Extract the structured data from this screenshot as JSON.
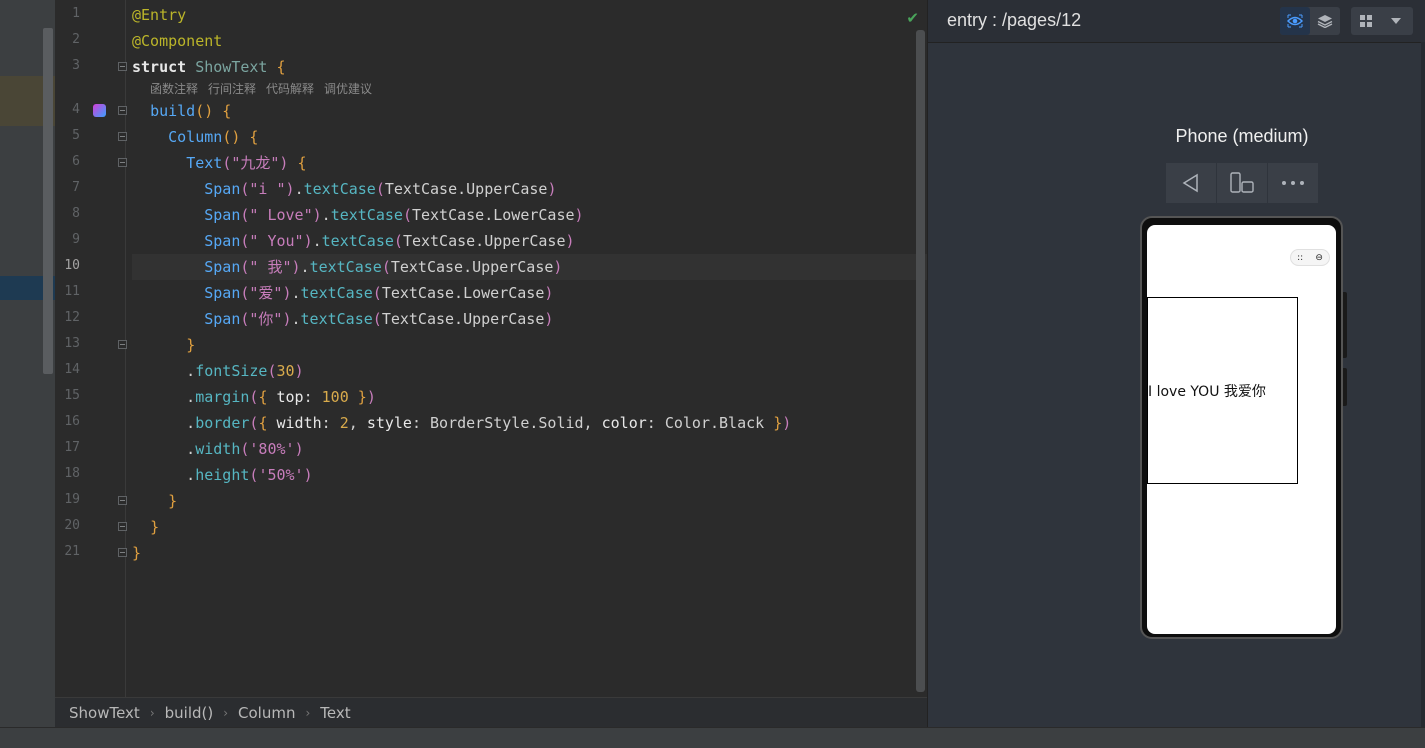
{
  "editor": {
    "lines": [
      {
        "n": "1",
        "tokens": [
          [
            "t-ann",
            "@Entry"
          ]
        ]
      },
      {
        "n": "2",
        "tokens": [
          [
            "t-ann",
            "@Component"
          ]
        ]
      },
      {
        "n": "3",
        "tokens": [
          [
            "t-kwp",
            "struct "
          ],
          [
            "t-cls",
            "ShowText "
          ],
          [
            "t-br",
            "{"
          ]
        ]
      },
      {
        "n": "4",
        "tokens": [
          [
            "t-plain",
            "  "
          ],
          [
            "t-fn",
            "build"
          ],
          [
            "t-br",
            "() {"
          ]
        ]
      },
      {
        "n": "5",
        "tokens": [
          [
            "t-plain",
            "    "
          ],
          [
            "t-fn",
            "Column"
          ],
          [
            "t-br",
            "() {"
          ]
        ]
      },
      {
        "n": "6",
        "tokens": [
          [
            "t-plain",
            "      "
          ],
          [
            "t-fn",
            "Text"
          ],
          [
            "t-br2",
            "("
          ],
          [
            "t-str",
            "\"九龙\""
          ],
          [
            "t-br2",
            ")"
          ],
          [
            "t-br",
            " {"
          ]
        ]
      },
      {
        "n": "7",
        "tokens": [
          [
            "t-plain",
            "        "
          ],
          [
            "t-fn",
            "Span"
          ],
          [
            "t-br2",
            "("
          ],
          [
            "t-str",
            "\"i \""
          ],
          [
            "t-br2",
            ")"
          ],
          [
            "t-plain",
            "."
          ],
          [
            "t-mth",
            "textCase"
          ],
          [
            "t-br2",
            "("
          ],
          [
            "t-plain",
            "TextCase.UpperCase"
          ],
          [
            "t-br2",
            ")"
          ]
        ]
      },
      {
        "n": "8",
        "tokens": [
          [
            "t-plain",
            "        "
          ],
          [
            "t-fn",
            "Span"
          ],
          [
            "t-br2",
            "("
          ],
          [
            "t-str",
            "\" Love\""
          ],
          [
            "t-br2",
            ")"
          ],
          [
            "t-plain",
            "."
          ],
          [
            "t-mth",
            "textCase"
          ],
          [
            "t-br2",
            "("
          ],
          [
            "t-plain",
            "TextCase.LowerCase"
          ],
          [
            "t-br2",
            ")"
          ]
        ]
      },
      {
        "n": "9",
        "tokens": [
          [
            "t-plain",
            "        "
          ],
          [
            "t-fn",
            "Span"
          ],
          [
            "t-br2",
            "("
          ],
          [
            "t-str",
            "\" You\""
          ],
          [
            "t-br2",
            ")"
          ],
          [
            "t-plain",
            "."
          ],
          [
            "t-mth",
            "textCase"
          ],
          [
            "t-br2",
            "("
          ],
          [
            "t-plain",
            "TextCase.UpperCase"
          ],
          [
            "t-br2",
            ")"
          ]
        ]
      },
      {
        "n": "10",
        "tokens": [
          [
            "t-plain",
            "        "
          ],
          [
            "t-fn",
            "Span"
          ],
          [
            "t-br2",
            "("
          ],
          [
            "t-str",
            "\" 我\""
          ],
          [
            "t-br2",
            ")"
          ],
          [
            "t-plain",
            "."
          ],
          [
            "t-mth",
            "textCase"
          ],
          [
            "t-br2",
            "("
          ],
          [
            "t-plain",
            "TextCase.UpperCase"
          ],
          [
            "t-br2",
            ")"
          ]
        ]
      },
      {
        "n": "11",
        "tokens": [
          [
            "t-plain",
            "        "
          ],
          [
            "t-fn",
            "Span"
          ],
          [
            "t-br2",
            "("
          ],
          [
            "t-str",
            "\"爱\""
          ],
          [
            "t-br2",
            ")"
          ],
          [
            "t-plain",
            "."
          ],
          [
            "t-mth",
            "textCase"
          ],
          [
            "t-br2",
            "("
          ],
          [
            "t-plain",
            "TextCase.LowerCase"
          ],
          [
            "t-br2",
            ")"
          ]
        ]
      },
      {
        "n": "12",
        "tokens": [
          [
            "t-plain",
            "        "
          ],
          [
            "t-fn",
            "Span"
          ],
          [
            "t-br2",
            "("
          ],
          [
            "t-str",
            "\"你\""
          ],
          [
            "t-br2",
            ")"
          ],
          [
            "t-plain",
            "."
          ],
          [
            "t-mth",
            "textCase"
          ],
          [
            "t-br2",
            "("
          ],
          [
            "t-plain",
            "TextCase.UpperCase"
          ],
          [
            "t-br2",
            ")"
          ]
        ]
      },
      {
        "n": "13",
        "tokens": [
          [
            "t-plain",
            "      "
          ],
          [
            "t-br",
            "}"
          ]
        ]
      },
      {
        "n": "14",
        "tokens": [
          [
            "t-plain",
            "      ."
          ],
          [
            "t-mth",
            "fontSize"
          ],
          [
            "t-br2",
            "("
          ],
          [
            "t-num",
            "30"
          ],
          [
            "t-br2",
            ")"
          ]
        ]
      },
      {
        "n": "15",
        "tokens": [
          [
            "t-plain",
            "      ."
          ],
          [
            "t-mth",
            "margin"
          ],
          [
            "t-br2",
            "("
          ],
          [
            "t-br",
            "{ "
          ],
          [
            "t-prop",
            "top"
          ],
          [
            "t-plain",
            ": "
          ],
          [
            "t-num",
            "100"
          ],
          [
            "t-br",
            " }"
          ],
          [
            "t-br2",
            ")"
          ]
        ]
      },
      {
        "n": "16",
        "tokens": [
          [
            "t-plain",
            "      ."
          ],
          [
            "t-mth",
            "border"
          ],
          [
            "t-br2",
            "("
          ],
          [
            "t-br",
            "{ "
          ],
          [
            "t-prop",
            "width"
          ],
          [
            "t-plain",
            ": "
          ],
          [
            "t-num",
            "2"
          ],
          [
            "t-plain",
            ", "
          ],
          [
            "t-prop",
            "style"
          ],
          [
            "t-plain",
            ": BorderStyle.Solid, "
          ],
          [
            "t-prop",
            "color"
          ],
          [
            "t-plain",
            ": Color.Black "
          ],
          [
            "t-br",
            "}"
          ],
          [
            "t-br2",
            ")"
          ]
        ]
      },
      {
        "n": "17",
        "tokens": [
          [
            "t-plain",
            "      ."
          ],
          [
            "t-mth",
            "width"
          ],
          [
            "t-br2",
            "("
          ],
          [
            "t-str",
            "'80%'"
          ],
          [
            "t-br2",
            ")"
          ]
        ]
      },
      {
        "n": "18",
        "tokens": [
          [
            "t-plain",
            "      ."
          ],
          [
            "t-mth",
            "height"
          ],
          [
            "t-br2",
            "("
          ],
          [
            "t-str",
            "'50%'"
          ],
          [
            "t-br2",
            ")"
          ]
        ]
      },
      {
        "n": "19",
        "tokens": [
          [
            "t-plain",
            "    "
          ],
          [
            "t-br",
            "}"
          ]
        ]
      },
      {
        "n": "20",
        "tokens": [
          [
            "t-plain",
            "  "
          ],
          [
            "t-br",
            "}"
          ]
        ]
      },
      {
        "n": "21",
        "tokens": [
          [
            "t-br",
            "}"
          ]
        ]
      }
    ],
    "current_line": "10",
    "code_hints": [
      "函数注释",
      "行间注释",
      "代码解释",
      "调优建议"
    ]
  },
  "breadcrumb": [
    "ShowText",
    "build()",
    "Column",
    "Text"
  ],
  "previewer": {
    "title": "entry : /pages/12",
    "device_name": "Phone (medium)",
    "rendered_text": "I  love YOU 我爱你",
    "capsule_left": "::",
    "capsule_right": "⊖"
  }
}
